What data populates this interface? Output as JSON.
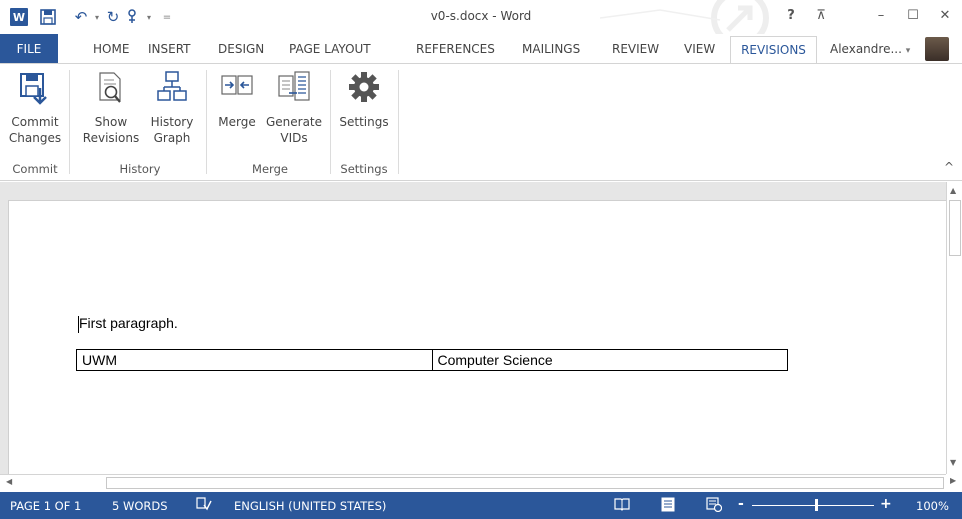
{
  "window": {
    "title": "v0-s.docx - Word",
    "help": "?",
    "minimize": "–",
    "restore": "☐",
    "close": "✕",
    "ribbon_display": "⊼"
  },
  "quick_access": {
    "undo_glyph": "↶",
    "redo_glyph": "↻",
    "customize": "="
  },
  "tabs": {
    "file": "FILE",
    "items": [
      "HOME",
      "INSERT",
      "DESIGN",
      "PAGE LAYOUT",
      "REFERENCES",
      "MAILINGS",
      "REVIEW",
      "VIEW"
    ],
    "active": "REVISIONS",
    "user": "Alexandre...",
    "user_dropdown": "▾"
  },
  "ribbon": {
    "commit": {
      "label_line1": "Commit",
      "label_line2": "Changes",
      "group": "Commit"
    },
    "show_revisions": {
      "label_line1": "Show",
      "label_line2": "Revisions"
    },
    "history_graph": {
      "label_line1": "History",
      "label_line2": "Graph"
    },
    "history_group": "History",
    "merge": {
      "label_line1": "Merge"
    },
    "generate_vids": {
      "label_line1": "Generate",
      "label_line2": "VIDs"
    },
    "merge_group": "Merge",
    "settings": {
      "label_line1": "Settings"
    },
    "settings_group": "Settings",
    "collapse": "^"
  },
  "document": {
    "paragraph": "First paragraph.",
    "table": [
      [
        "UWM",
        "Computer Science"
      ]
    ]
  },
  "status": {
    "page": "PAGE 1 OF 1",
    "words": "5 WORDS",
    "language": "ENGLISH (UNITED STATES)",
    "zoom_minus": "-",
    "zoom_plus": "+",
    "zoom": "100%"
  },
  "colors": {
    "accent": "#2b579a"
  }
}
